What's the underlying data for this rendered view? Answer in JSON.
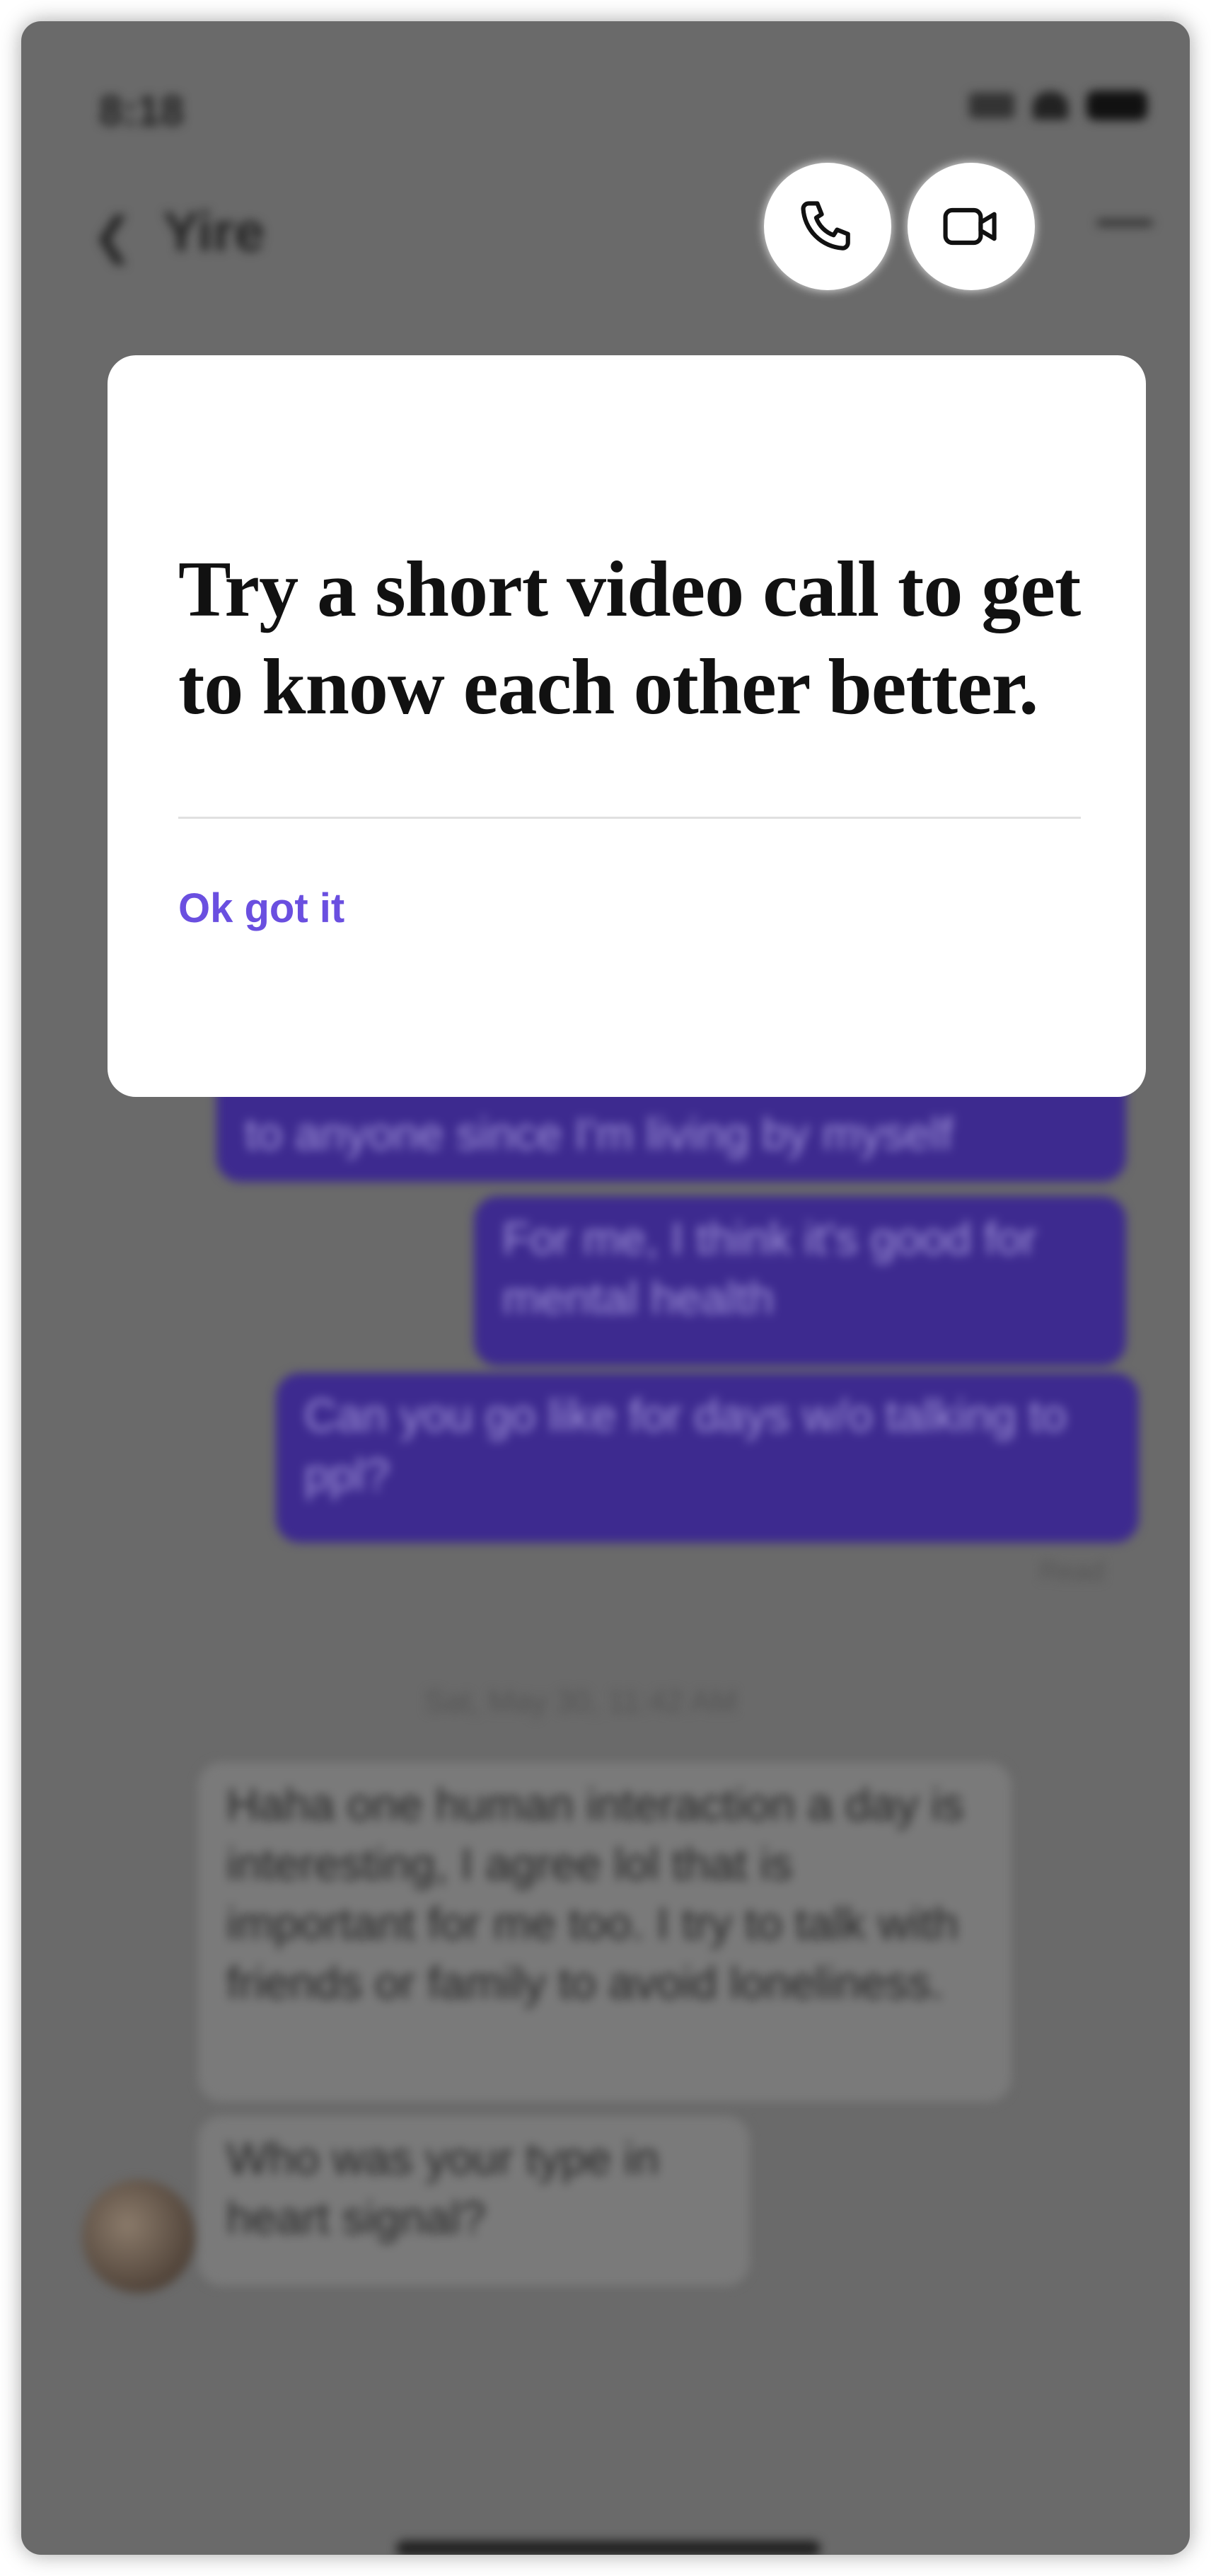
{
  "status_bar": {
    "time": "8:18"
  },
  "header": {
    "back_icon": "chevron-left-icon",
    "contact_name": "Yire",
    "more_icon": "more-horizontal-icon"
  },
  "call_buttons": {
    "voice_icon": "phone-icon",
    "video_icon": "video-camera-icon"
  },
  "messages_outgoing": [
    "to anyone since I'm living by myself",
    "For me, I think it's good for mental health",
    "Can you go like for days w/o talking to ppl?"
  ],
  "read_receipt": "Read",
  "timestamp": "Sat, May 30, 11:42 AM",
  "messages_incoming": [
    "Haha one human interaction a day is interesting, I agree lol that is important for me too. I try to talk with friends or family to avoid loneliness.",
    "Who was your type in heart signal?"
  ],
  "popup": {
    "title": "Try a short video call to get to know each other better.",
    "ok_label": "Ok got it"
  },
  "colors": {
    "accent": "#6a4fe0",
    "bubble_out": "#3d2a8f",
    "overlay": "#6a6a6a"
  }
}
